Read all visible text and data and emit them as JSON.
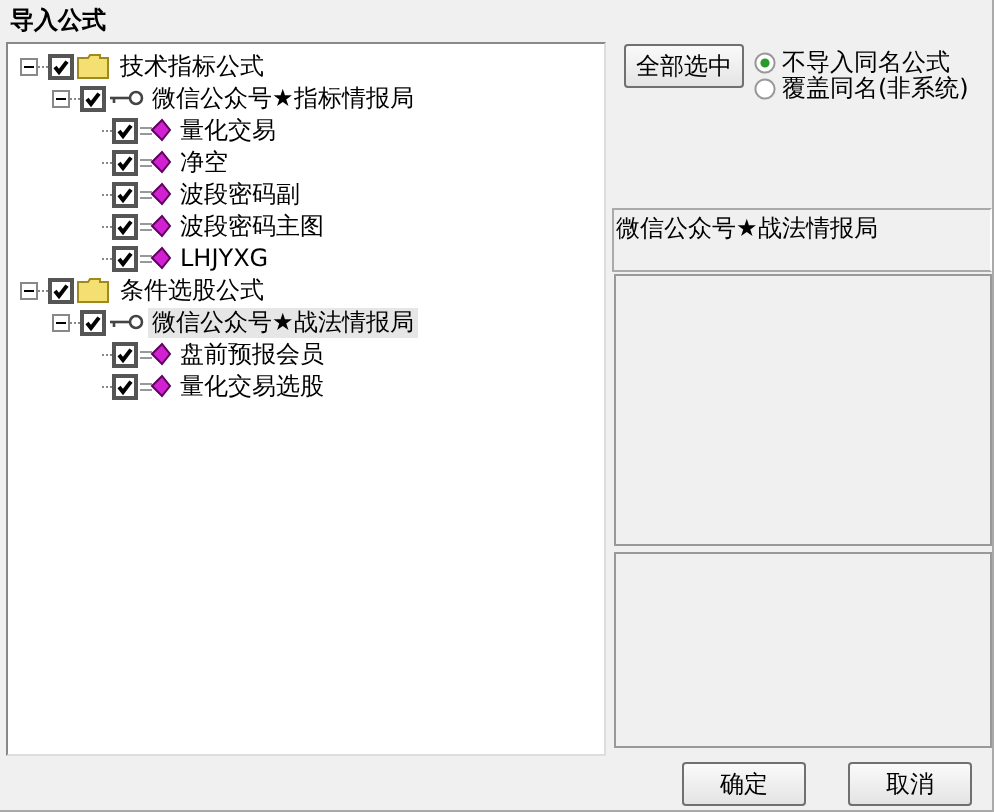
{
  "window": {
    "title": "导入公式"
  },
  "tree": [
    {
      "kind": "group",
      "label": "技术指标公式",
      "checked": true,
      "expanded": true,
      "selected": false,
      "children": [
        {
          "kind": "author",
          "label": "微信公众号★指标情报局",
          "checked": true,
          "expanded": true,
          "selected": false,
          "children": [
            {
              "kind": "formula",
              "label": "量化交易",
              "checked": true,
              "selected": false
            },
            {
              "kind": "formula",
              "label": "净空",
              "checked": true,
              "selected": false
            },
            {
              "kind": "formula",
              "label": "波段密码副",
              "checked": true,
              "selected": false
            },
            {
              "kind": "formula",
              "label": "波段密码主图",
              "checked": true,
              "selected": false
            },
            {
              "kind": "formula",
              "label": "LHJYXG",
              "checked": true,
              "selected": false
            }
          ]
        }
      ]
    },
    {
      "kind": "group",
      "label": "条件选股公式",
      "checked": true,
      "expanded": true,
      "selected": false,
      "children": [
        {
          "kind": "author",
          "label": "微信公众号★战法情报局",
          "checked": true,
          "expanded": true,
          "selected": true,
          "children": [
            {
              "kind": "formula",
              "label": "盘前预报会员",
              "checked": true,
              "selected": false
            },
            {
              "kind": "formula",
              "label": "量化交易选股",
              "checked": true,
              "selected": false
            }
          ]
        }
      ]
    }
  ],
  "select_all_button": "全部选中",
  "options": [
    {
      "label": "不导入同名公式",
      "selected": true
    },
    {
      "label": "覆盖同名(非系统)",
      "selected": false
    }
  ],
  "info_text": "微信公众号★战法情报局",
  "buttons": [
    "确定",
    "取消"
  ]
}
